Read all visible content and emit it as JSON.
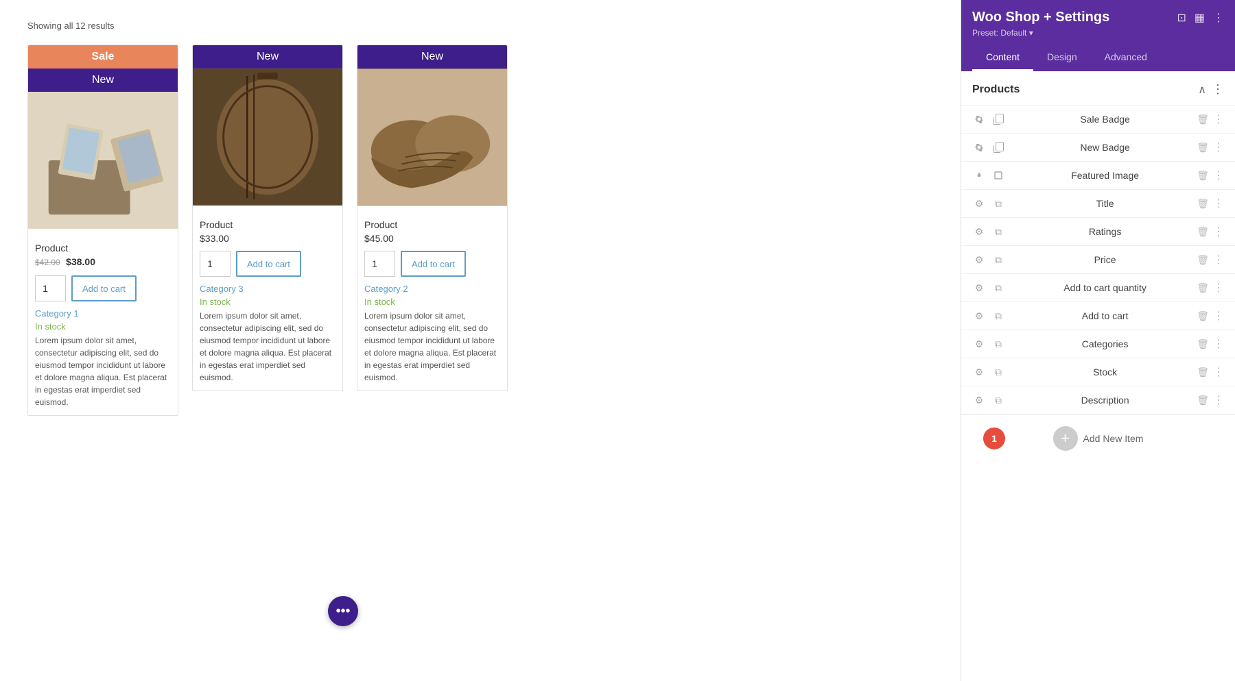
{
  "results": {
    "text": "Showing all 12 results"
  },
  "products": [
    {
      "id": "product-1",
      "badge_sale": "Sale",
      "badge_new": "New",
      "image_type": "camera",
      "name": "Product",
      "price_old": "$42.00",
      "price_new": "$38.00",
      "qty": "1",
      "add_to_cart": "Add to cart",
      "category": "Category 1",
      "stock": "In stock",
      "description": "Lorem ipsum dolor sit amet, consectetur adipiscing elit, sed do eiusmod tempor incididunt ut labore et dolore magna aliqua. Est placerat in egestas erat imperdiet sed euismod."
    },
    {
      "id": "product-2",
      "badge_new": "New",
      "image_type": "bag",
      "name": "Product",
      "price": "$33.00",
      "qty": "1",
      "add_to_cart": "Add to cart",
      "category": "Category 3",
      "stock": "In stock",
      "description": "Lorem ipsum dolor sit amet, consectetur adipiscing elit, sed do eiusmod tempor incididunt ut labore et dolore magna aliqua. Est placerat in egestas erat imperdiet sed euismod."
    },
    {
      "id": "product-3",
      "badge_new": "New",
      "image_type": "shoes",
      "name": "Product",
      "price": "$45.00",
      "qty": "1",
      "add_to_cart": "Add to cart",
      "category": "Category 2",
      "stock": "In stock",
      "description": "Lorem ipsum dolor sit amet, consectetur adipiscing elit, sed do eiusmod tempor incididunt ut labore et dolore magna aliqua. Est placerat in egestas erat imperdiet sed euismod."
    }
  ],
  "floating_btn": "•••",
  "panel": {
    "title": "Woo Shop + Settings",
    "preset": "Preset: Default ▾",
    "tabs": [
      "Content",
      "Design",
      "Advanced"
    ],
    "active_tab": "Content",
    "section_title": "Products",
    "items": [
      {
        "label": "Sale Badge"
      },
      {
        "label": "New Badge"
      },
      {
        "label": "Featured Image"
      },
      {
        "label": "Title"
      },
      {
        "label": "Ratings"
      },
      {
        "label": "Price"
      },
      {
        "label": "Add to cart quantity"
      },
      {
        "label": "Add to cart"
      },
      {
        "label": "Categories"
      },
      {
        "label": "Stock"
      },
      {
        "label": "Description"
      }
    ],
    "notification_count": "1",
    "add_new_label": "Add New Item"
  },
  "bottom_bar": {
    "btn1": "◀",
    "btn2": "▶",
    "btn3": "✓"
  }
}
